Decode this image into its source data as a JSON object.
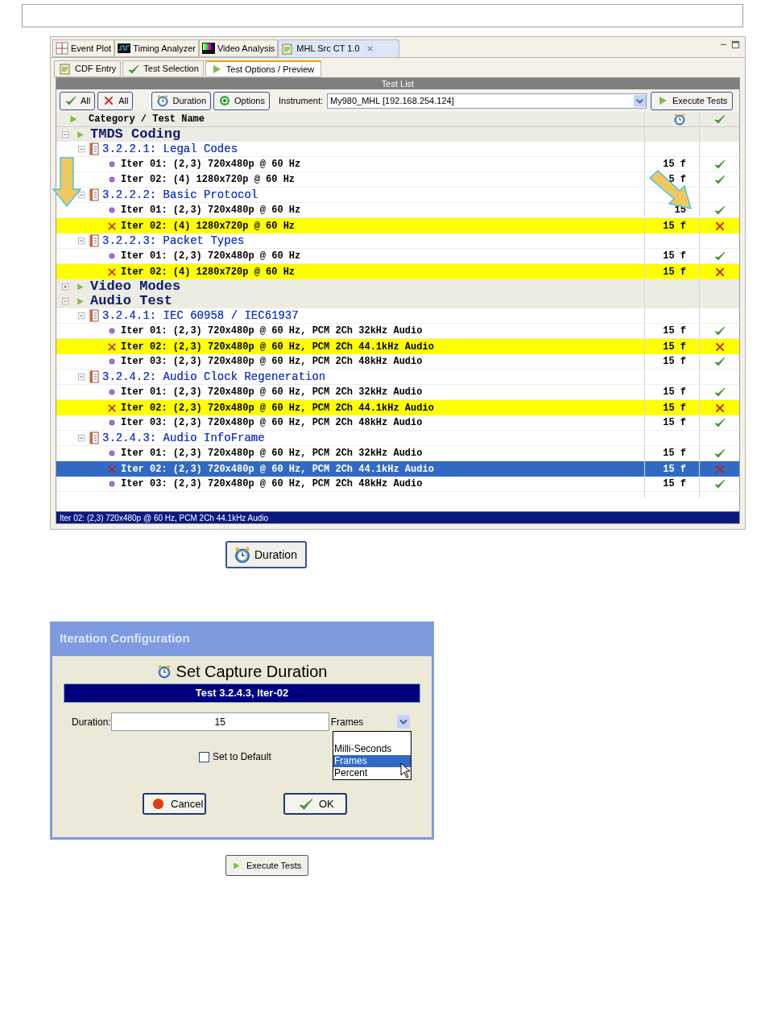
{
  "editor_tabs": [
    {
      "label": "Event Plot",
      "selected": false
    },
    {
      "label": "Timing Analyzer",
      "selected": false
    },
    {
      "label": "Video Analysis",
      "selected": false
    },
    {
      "label": "MHL Src CT 1.0",
      "selected": true,
      "closable": true
    }
  ],
  "sub_tabs": [
    {
      "label": "CDF Entry",
      "selected": false
    },
    {
      "label": "Test Selection",
      "selected": false
    },
    {
      "label": "Test Options / Preview",
      "selected": true
    }
  ],
  "panel_title": "Test List",
  "toolbar": {
    "buttons": [
      "All",
      "All",
      "Duration",
      "Options"
    ],
    "instrument_label": "Instrument:",
    "instrument_value": "My980_MHL [192.168.254.124]",
    "execute_button": "Execute Tests"
  },
  "tree": {
    "column_name": "Category / Test Name",
    "categories": [
      {
        "name": "TMDS Coding",
        "expanded": true,
        "children": [
          {
            "name": "3.2.2.1: Legal Codes",
            "expanded": true,
            "children": [
              {
                "name": "Iter 01: (2,3) 720x480p @ 60 Hz",
                "duration": "15 f",
                "kind": "pass",
                "highlighted": false,
                "selected": false
              },
              {
                "name": "Iter 02: (4) 1280x720p @ 60 Hz",
                "duration": "5 f",
                "kind": "pass",
                "highlighted": false,
                "selected": false
              }
            ]
          },
          {
            "name": "3.2.2.2: Basic Protocol",
            "expanded": true,
            "children": [
              {
                "name": "Iter 01: (2,3) 720x480p @ 60 Hz",
                "duration": "15",
                "kind": "pass",
                "highlighted": false,
                "selected": false
              },
              {
                "name": "Iter 02: (4) 1280x720p @ 60 Hz",
                "duration": "15 f",
                "kind": "fail",
                "highlighted": true,
                "selected": false
              }
            ]
          },
          {
            "name": "3.2.2.3: Packet Types",
            "expanded": true,
            "children": [
              {
                "name": "Iter 01: (2,3) 720x480p @ 60 Hz",
                "duration": "15 f",
                "kind": "pass",
                "highlighted": false,
                "selected": false
              },
              {
                "name": "Iter 02: (4) 1280x720p @ 60 Hz",
                "duration": "15 f",
                "kind": "fail",
                "highlighted": true,
                "selected": false
              }
            ]
          }
        ]
      },
      {
        "name": "Video Modes",
        "expanded": false
      },
      {
        "name": "Audio Test",
        "expanded": true,
        "children": [
          {
            "name": "3.2.4.1: IEC 60958 / IEC61937",
            "expanded": true,
            "children": [
              {
                "name": "Iter 01: (2,3) 720x480p @ 60 Hz, PCM 2Ch 32kHz Audio",
                "duration": "15 f",
                "kind": "pass",
                "highlighted": false,
                "selected": false
              },
              {
                "name": "Iter 02: (2,3) 720x480p @ 60 Hz, PCM 2Ch 44.1kHz Audio",
                "duration": "15 f",
                "kind": "fail",
                "highlighted": true,
                "selected": false
              },
              {
                "name": "Iter 03: (2,3) 720x480p @ 60 Hz, PCM 2Ch 48kHz Audio",
                "duration": "15 f",
                "kind": "pass",
                "highlighted": false,
                "selected": false
              }
            ]
          },
          {
            "name": "3.2.4.2: Audio Clock Regeneration",
            "expanded": true,
            "children": [
              {
                "name": "Iter 01: (2,3) 720x480p @ 60 Hz, PCM 2Ch 32kHz Audio",
                "duration": "15 f",
                "kind": "pass",
                "highlighted": false,
                "selected": false
              },
              {
                "name": "Iter 02: (2,3) 720x480p @ 60 Hz, PCM 2Ch 44.1kHz Audio",
                "duration": "15 f",
                "kind": "fail",
                "highlighted": true,
                "selected": false
              },
              {
                "name": "Iter 03: (2,3) 720x480p @ 60 Hz, PCM 2Ch 48kHz Audio",
                "duration": "15 f",
                "kind": "pass",
                "highlighted": false,
                "selected": false
              }
            ]
          },
          {
            "name": "3.2.4.3: Audio InfoFrame",
            "expanded": true,
            "children": [
              {
                "name": "Iter 01: (2,3) 720x480p @ 60 Hz, PCM 2Ch 32kHz Audio",
                "duration": "15 f",
                "kind": "pass",
                "highlighted": false,
                "selected": false
              },
              {
                "name": "Iter 02: (2,3) 720x480p @ 60 Hz, PCM 2Ch 44.1kHz Audio",
                "duration": "15 f",
                "kind": "fail",
                "highlighted": false,
                "selected": true
              },
              {
                "name": "Iter 03: (2,3) 720x480p @ 60 Hz, PCM 2Ch 48kHz Audio",
                "duration": "15 f",
                "kind": "pass",
                "highlighted": false,
                "selected": false
              }
            ]
          }
        ]
      }
    ]
  },
  "status_bar": "Iter 02: (2,3) 720x480p @ 60 Hz, PCM 2Ch 44.1kHz Audio",
  "duration_callout": "Duration",
  "dialog": {
    "title": "Iteration Configuration",
    "heading": "Set Capture Duration",
    "subtitle": "Test 3.2.4.3, Iter-02",
    "duration_label": "Duration:",
    "duration_value": "15",
    "unit_value": "Frames",
    "unit_options": [
      {
        "label": "Milli-Seconds",
        "selected": false
      },
      {
        "label": "Frames",
        "selected": true
      },
      {
        "label": "Percent",
        "selected": false
      }
    ],
    "default_checkbox": {
      "label": "Set to Default",
      "checked": false
    },
    "cancel_button": "Cancel",
    "ok_button": "OK"
  },
  "execute_callout": "Execute Tests"
}
